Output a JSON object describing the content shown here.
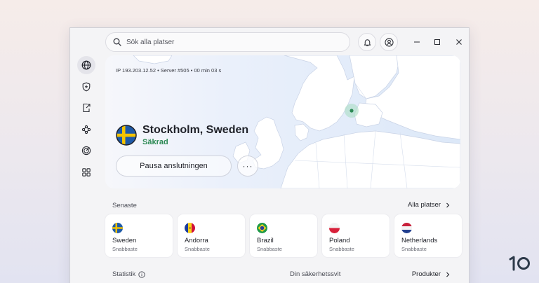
{
  "search": {
    "placeholder": "Sök alla platser",
    "icon": "search-icon"
  },
  "titlebar": {
    "icons": [
      "bell-icon",
      "account-icon",
      "minimize-icon",
      "maximize-icon",
      "close-icon"
    ]
  },
  "sidebar": {
    "items": [
      {
        "icon": "globe-icon",
        "active": true
      },
      {
        "icon": "shield-plus-icon",
        "active": false
      },
      {
        "icon": "file-export-icon",
        "active": false
      },
      {
        "icon": "meshnet-icon",
        "active": false
      },
      {
        "icon": "radar-icon",
        "active": false
      },
      {
        "icon": "apps-grid-icon",
        "active": false
      }
    ]
  },
  "connection": {
    "info": "IP 193.203.12.52 • Server #505 • 00 min 03 s",
    "city": "Stockholm, Sweden",
    "status": "Säkrad",
    "pause_label": "Pausa anslutningen",
    "more_label": "···"
  },
  "recent": {
    "title": "Senaste",
    "all_link": "Alla platser",
    "items": [
      {
        "name": "Sweden",
        "sub": "Snabbaste",
        "flag": "sweden"
      },
      {
        "name": "Andorra",
        "sub": "Snabbaste",
        "flag": "andorra"
      },
      {
        "name": "Brazil",
        "sub": "Snabbaste",
        "flag": "brazil"
      },
      {
        "name": "Poland",
        "sub": "Snabbaste",
        "flag": "poland"
      },
      {
        "name": "Netherlands",
        "sub": "Snabbaste",
        "flag": "netherlands"
      }
    ]
  },
  "footer": {
    "stats_label": "Statistik",
    "suite_label": "Din säkerhetssvit",
    "products_link": "Produkter"
  },
  "logo": {
    "text": "10"
  },
  "colors": {
    "secured": "#2d8a55",
    "map_land": "#ffffff",
    "map_sea": "#dce8f8",
    "pin": "#2d8a55"
  }
}
